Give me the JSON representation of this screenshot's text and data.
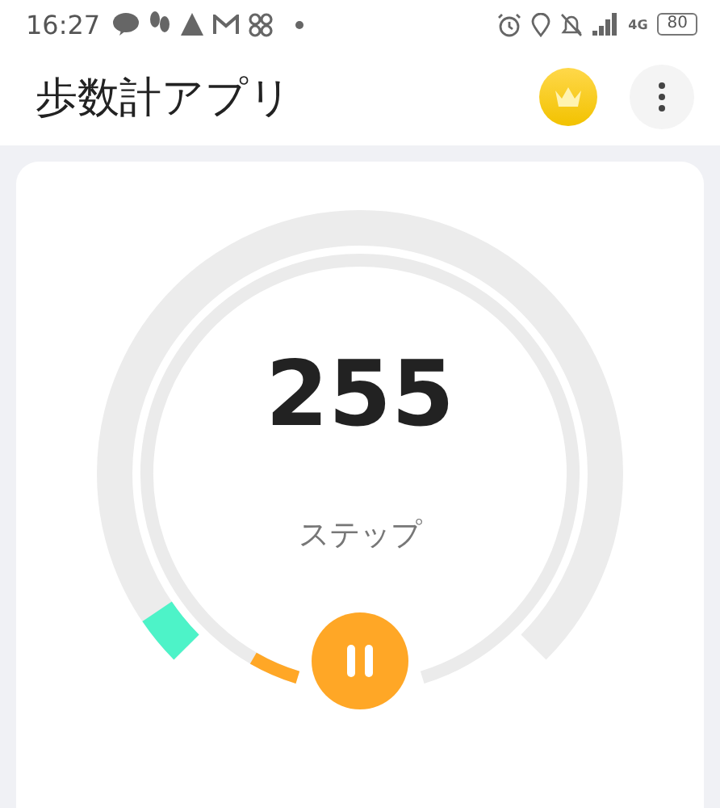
{
  "status_bar": {
    "time": "16:27",
    "network": "4G",
    "battery": "80"
  },
  "app_bar": {
    "title": "歩数計アプリ"
  },
  "counter": {
    "steps": "255",
    "unit": "ステップ",
    "paused": false
  }
}
